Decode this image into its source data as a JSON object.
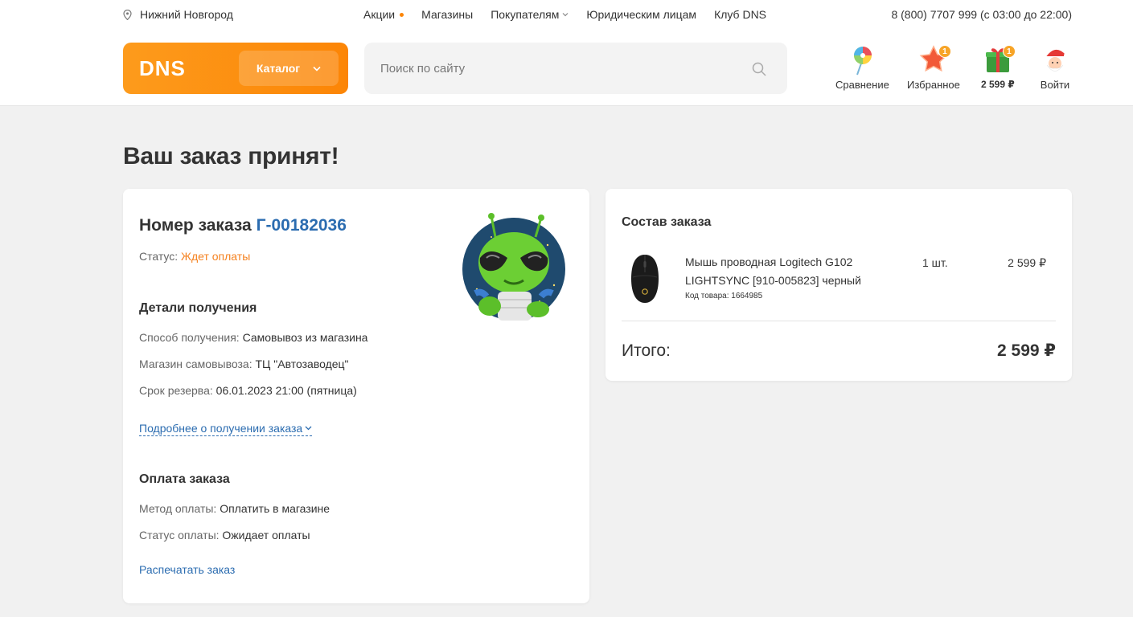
{
  "header": {
    "city": "Нижний Новгород",
    "nav": [
      {
        "label": "Акции",
        "dot": true
      },
      {
        "label": "Магазины"
      },
      {
        "label": "Покупателям",
        "chevron": true
      },
      {
        "label": "Юридическим лицам"
      },
      {
        "label": "Клуб DNS"
      }
    ],
    "phone": "8 (800) 7707 999 (с 03:00 до 22:00)",
    "logo_text": "DNS",
    "catalog_label": "Каталог",
    "search_placeholder": "Поиск по сайту",
    "actions": {
      "compare": "Сравнение",
      "favorites": "Избранное",
      "favorites_badge": "1",
      "cart": "2 599 ₽",
      "cart_badge": "1",
      "login": "Войти"
    },
    "accent_color": "#fc8507"
  },
  "page": {
    "title": "Ваш заказ принят!"
  },
  "order": {
    "number_label": "Номер заказа",
    "number": "Г-00182036",
    "status_label": "Статус:",
    "status_value": "Ждет оплаты",
    "delivery": {
      "title": "Детали получения",
      "method_label": "Способ получения:",
      "method_value": "Самовывоз из магазина",
      "store_label": "Магазин самовывоза:",
      "store_value": "ТЦ \"Автозаводец\"",
      "reserve_label": "Срок резерва:",
      "reserve_value": "06.01.2023 21:00 (пятница)",
      "more_link": "Подробнее о получении заказа"
    },
    "payment": {
      "title": "Оплата заказа",
      "method_label": "Метод оплаты:",
      "method_value": "Оплатить в магазине",
      "status_label": "Статус оплаты:",
      "status_value": "Ожидает оплаты"
    },
    "print_link": "Распечатать заказ"
  },
  "composition": {
    "title": "Состав заказа",
    "items": [
      {
        "name": "Мышь проводная Logitech G102 LIGHTSYNC [910-005823] черный",
        "code": "Код товара: 1664985",
        "qty": "1 шт.",
        "price": "2 599 ₽"
      }
    ],
    "total_label": "Итого:",
    "total_value": "2 599 ₽"
  }
}
